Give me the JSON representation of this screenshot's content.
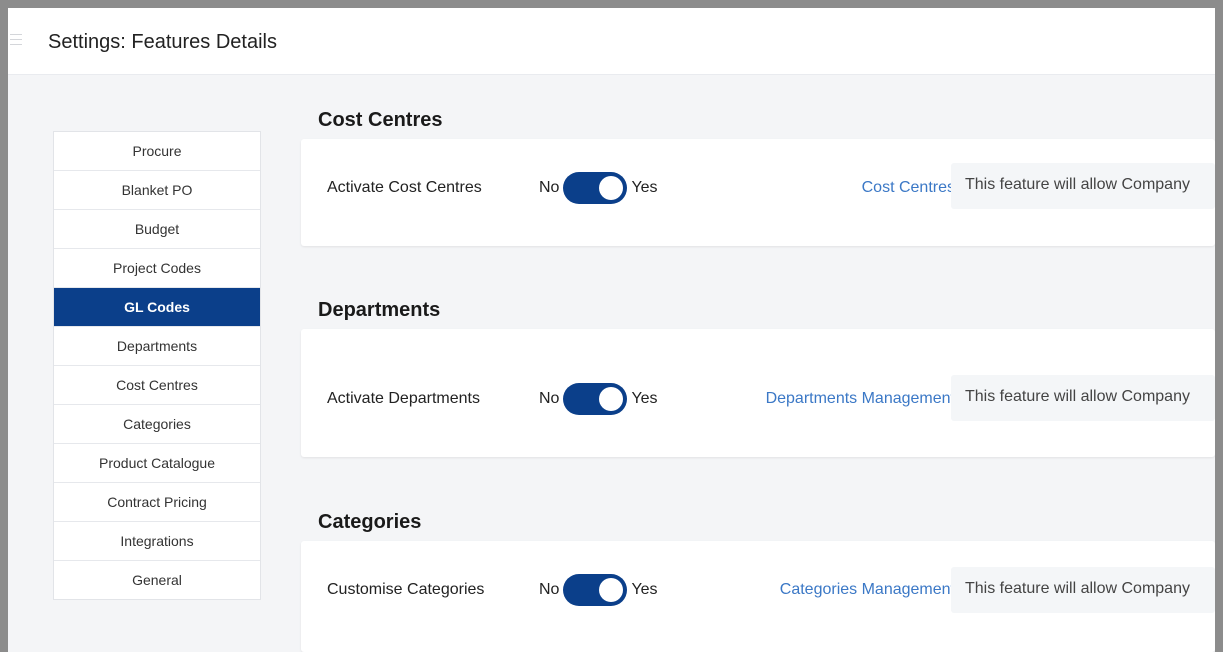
{
  "header": {
    "title": "Settings: Features Details"
  },
  "sidebar": {
    "items": [
      {
        "label": "Procure"
      },
      {
        "label": "Blanket PO"
      },
      {
        "label": "Budget"
      },
      {
        "label": "Project Codes"
      },
      {
        "label": "GL Codes",
        "active": true
      },
      {
        "label": "Departments"
      },
      {
        "label": "Cost Centres"
      },
      {
        "label": "Categories"
      },
      {
        "label": "Product Catalogue"
      },
      {
        "label": "Contract Pricing"
      },
      {
        "label": "Integrations"
      },
      {
        "label": "General"
      }
    ]
  },
  "sections": [
    {
      "title": "Cost Centres",
      "row_label": "Activate Cost Centres",
      "toggle": {
        "off_label": "No",
        "on_label": "Yes",
        "state": "on"
      },
      "link": "Cost Centres",
      "description": "This feature will allow Company"
    },
    {
      "title": "Departments",
      "row_label": "Activate Departments",
      "toggle": {
        "off_label": "No",
        "on_label": "Yes",
        "state": "on"
      },
      "link": "Departments Management",
      "description": "This feature will allow Company"
    },
    {
      "title": "Categories",
      "row_label": "Customise Categories",
      "toggle": {
        "off_label": "No",
        "on_label": "Yes",
        "state": "on"
      },
      "link": "Categories Management",
      "description": "This feature will allow Company"
    }
  ],
  "colors": {
    "accent": "#0b3f8a",
    "link": "#3b78c6",
    "background": "#f4f5f7"
  }
}
